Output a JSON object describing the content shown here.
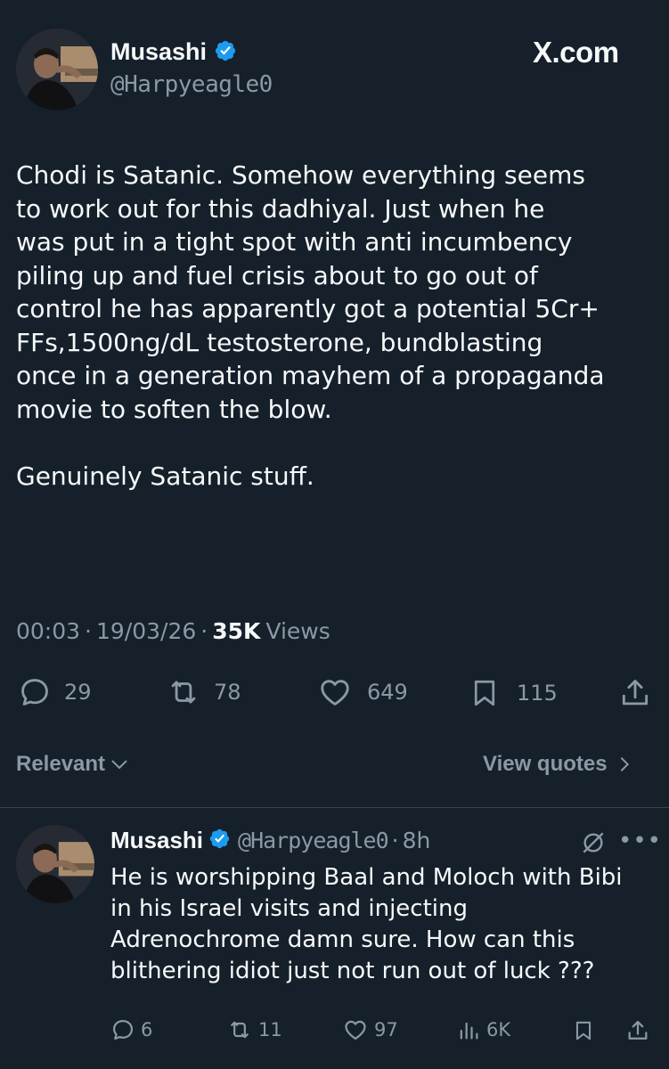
{
  "tweet": {
    "author_name": "Musashi",
    "author_handle": "@Harpyeagle0",
    "brand": "X.com",
    "text": "Chodi is Satanic. Somehow everything seems\nto work out for this dadhiyal. Just when he\nwas put in a tight spot with anti incumbency\npiling up and fuel crisis about to go out of\ncontrol he has apparently got a potential 5Cr+\nFFs,1500ng/dL testosterone, bundblasting\nonce in a generation mayhem of a propaganda\nmovie to soften the blow.\n\nGenuinely Satanic stuff.",
    "time": "00:03",
    "date": "19/03/26",
    "views_count": "35K",
    "views_label": "Views",
    "replies": "29",
    "reposts": "78",
    "likes": "649",
    "bookmarks": "115"
  },
  "filter": {
    "sort_label": "Relevant",
    "view_quotes_label": "View quotes"
  },
  "reply": {
    "author_name": "Musashi",
    "author_handle": "@Harpyeagle0",
    "time_ago": "8h",
    "text": "He is worshipping Baal and Moloch with Bibi\nin his Israel visits and injecting\nAdrenochrome damn sure. How can this\nblithering idiot just not run out of luck ???",
    "replies": "6",
    "reposts": "11",
    "likes": "97",
    "views": "6K"
  },
  "colors": {
    "background": "#15202b",
    "text": "#f7f9f9",
    "muted": "#8b98a5",
    "verified": "#1d9bf0",
    "divider": "#38444d"
  }
}
